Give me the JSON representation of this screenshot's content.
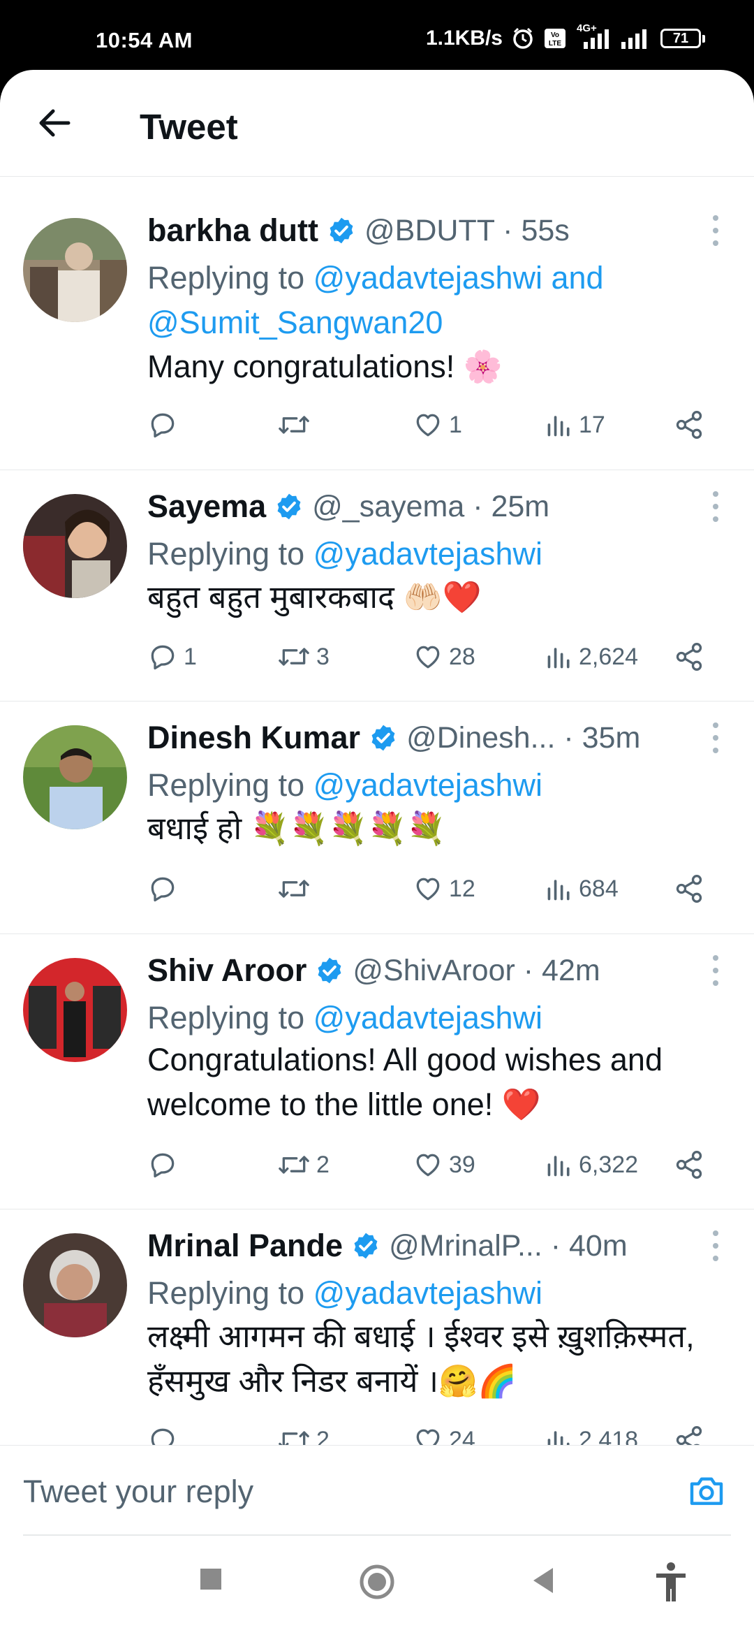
{
  "status_bar": {
    "time": "10:54 AM",
    "speed": "1.1KB/s",
    "network": "4G+",
    "battery": "71"
  },
  "header": {
    "title": "Tweet",
    "back_icon": "arrow-left-icon"
  },
  "tweets": [
    {
      "name": "barkha dutt",
      "handle_time": "@BDUTT · 55s",
      "reply_prefix": "Replying to ",
      "mention": "@yadavtejashwi and @Sumit_Sangwan20",
      "text": "Many congratulations! 🌸",
      "replies": "",
      "retweets": "",
      "likes": "1",
      "views": "17"
    },
    {
      "name": "Sayema",
      "handle_time": "@_sayema · 25m",
      "reply_prefix": "Replying to ",
      "mention": "@yadavtejashwi",
      "text": "बहुत बहुत मुबारकबाद 🤲🏻❤️",
      "replies": "1",
      "retweets": "3",
      "likes": "28",
      "views": "2,624"
    },
    {
      "name": "Dinesh Kumar",
      "handle_time": "@Dinesh... · 35m",
      "reply_prefix": "Replying to ",
      "mention": "@yadavtejashwi",
      "text": "बधाई हो 💐💐💐💐💐",
      "replies": "",
      "retweets": "",
      "likes": "12",
      "views": "684"
    },
    {
      "name": "Shiv Aroor",
      "handle_time": "@ShivAroor · 42m",
      "reply_prefix": "Replying to ",
      "mention": "@yadavtejashwi",
      "text": "Congratulations! All good wishes and welcome to the little one! ❤️",
      "replies": "",
      "retweets": "2",
      "likes": "39",
      "views": "6,322"
    },
    {
      "name": "Mrinal Pande",
      "handle_time": "@MrinalP... · 40m",
      "reply_prefix": "Replying to ",
      "mention": "@yadavtejashwi",
      "text": "लक्ष्मी आगमन की बधाई । ईश्वर इसे ख़ुशक़िस्मत, हँसमुख और निडर बनायें ।🤗🌈",
      "replies": "",
      "retweets": "2",
      "likes": "24",
      "views": "2,418"
    }
  ],
  "reply_box": {
    "placeholder": "Tweet your reply",
    "camera_icon": "camera-icon"
  },
  "colors": {
    "accent": "#1d9bf0",
    "secondary_text": "#536471",
    "primary_text": "#0f1419"
  }
}
